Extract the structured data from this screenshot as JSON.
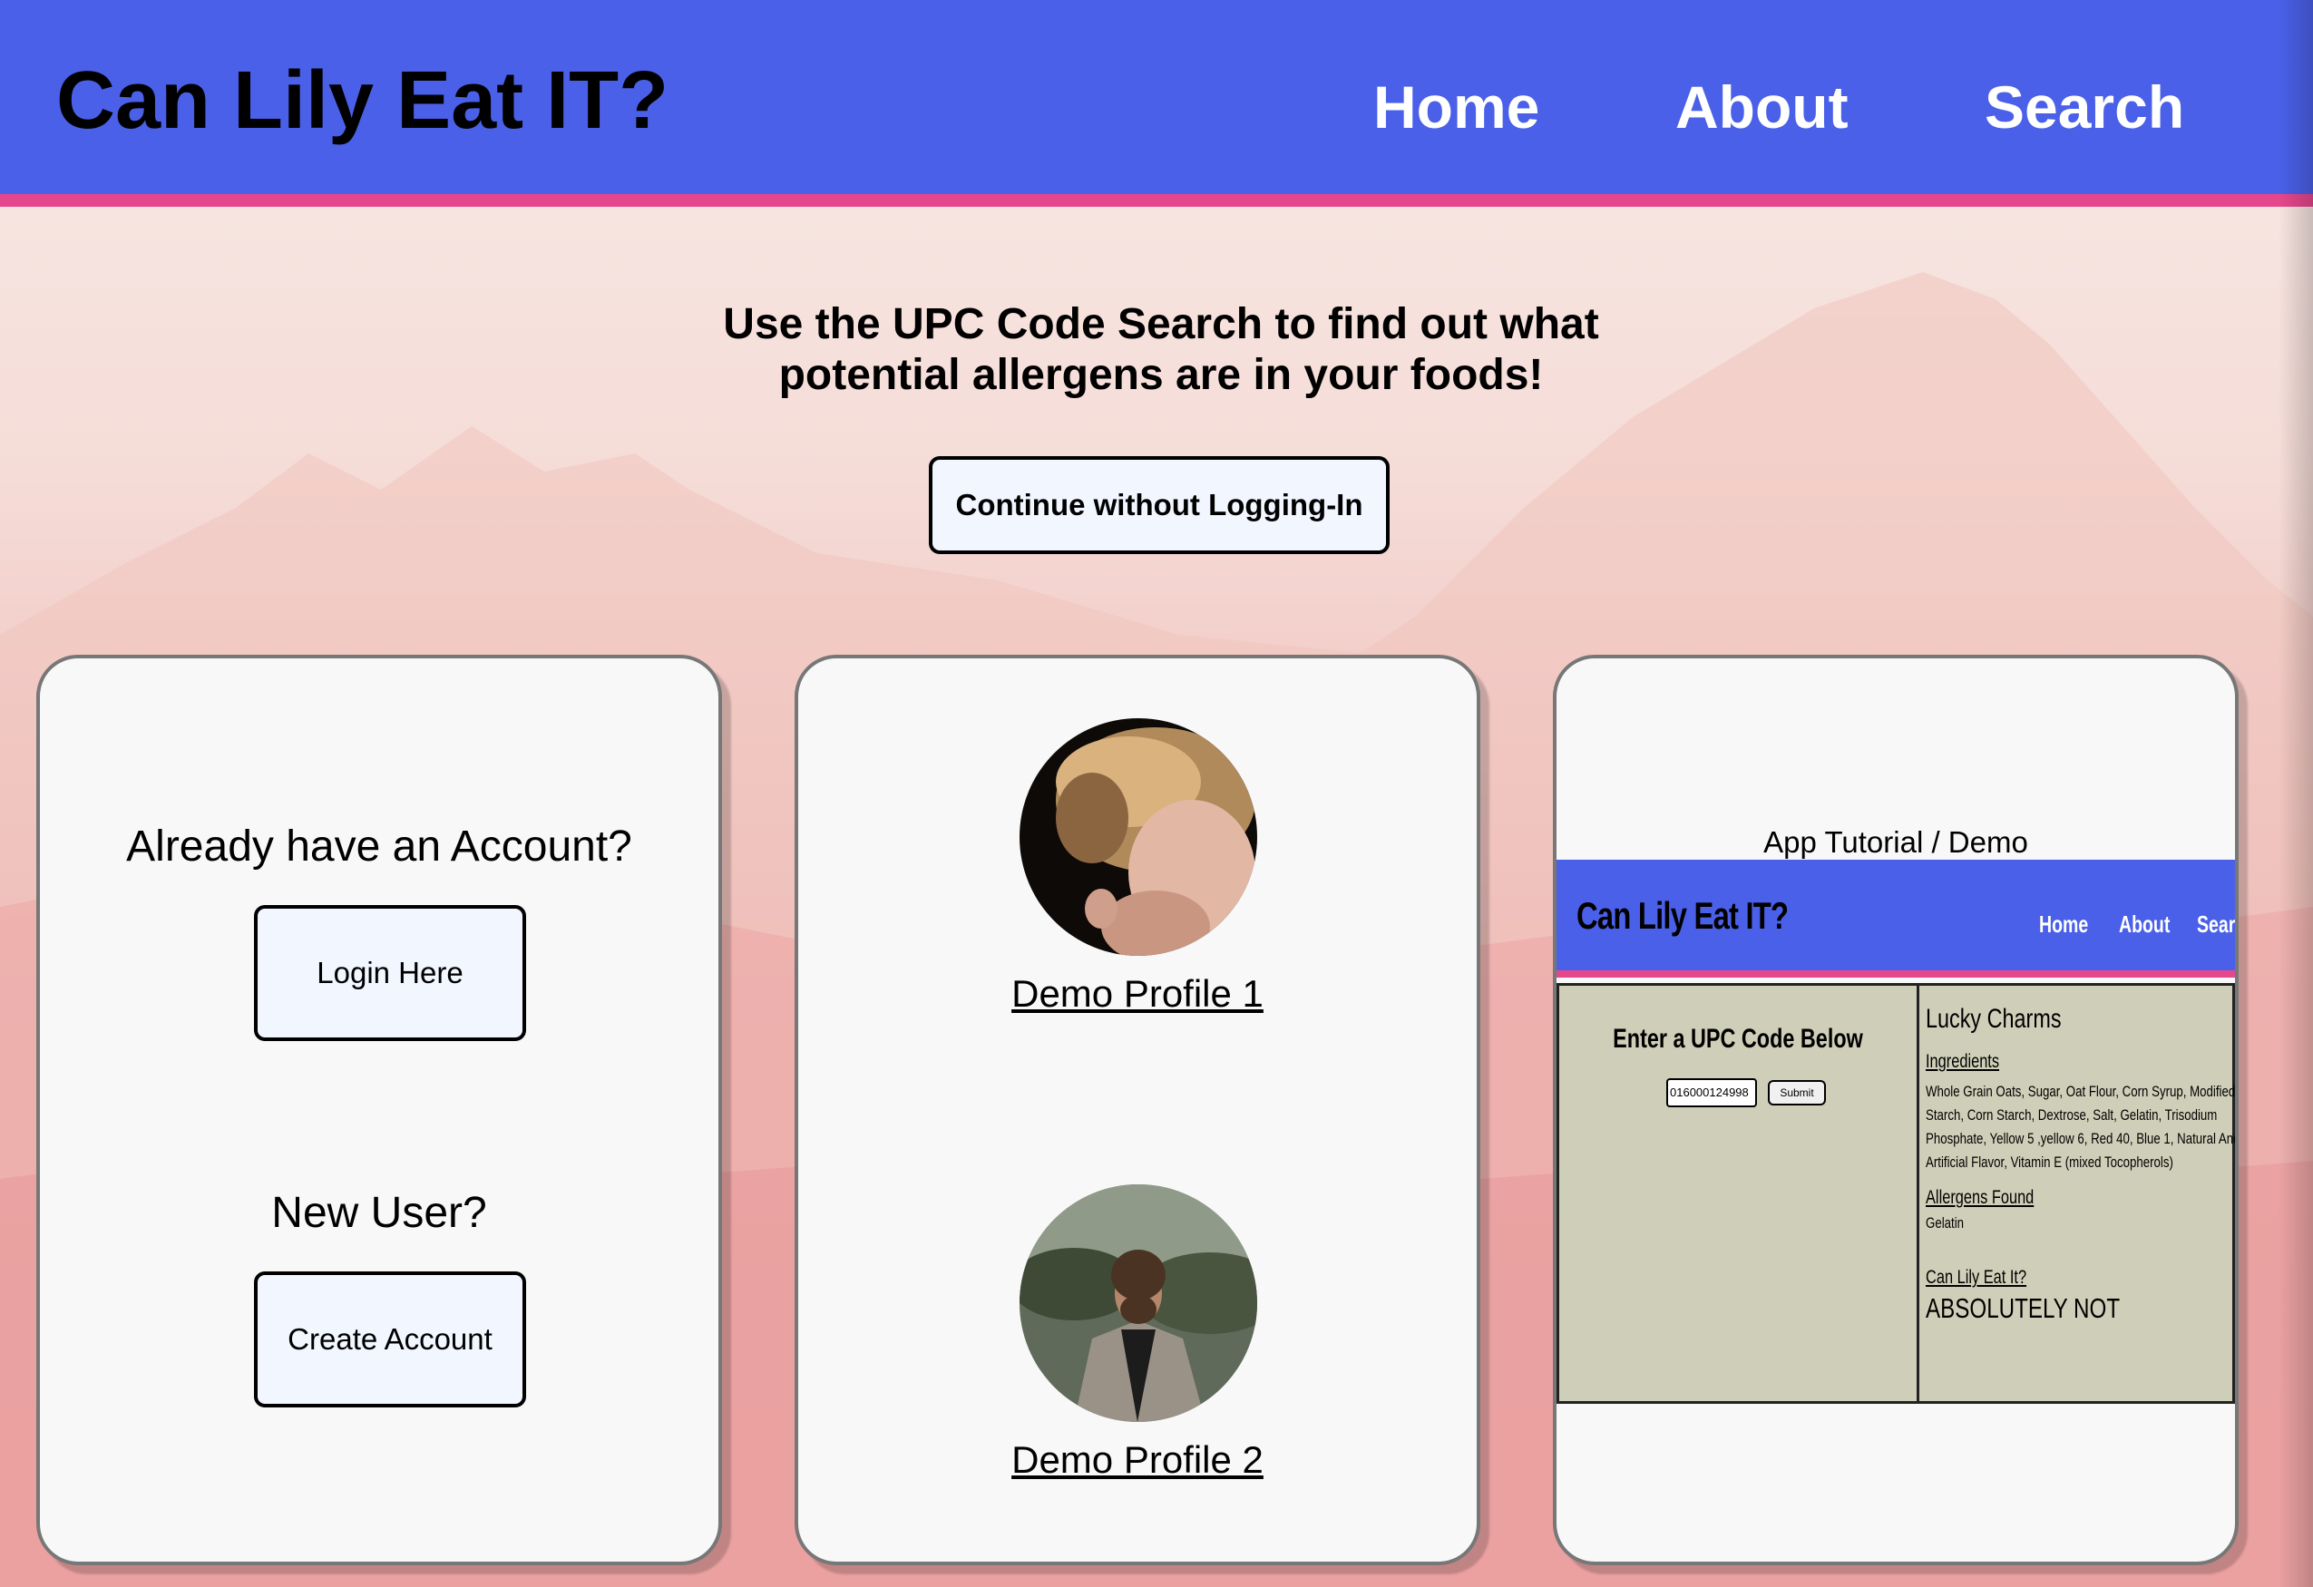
{
  "header": {
    "brand": "Can Lily Eat IT?",
    "nav": [
      {
        "label": "Home"
      },
      {
        "label": "About"
      },
      {
        "label": "Search"
      }
    ]
  },
  "hero": {
    "line1": "Use the UPC Code Search to find out what",
    "line2": "potential allergens are in your foods!",
    "continue_button": "Continue without Logging-In"
  },
  "account_card": {
    "existing_heading": "Already have an Account?",
    "login_button": "Login Here",
    "new_heading": "New User?",
    "create_button": "Create Account"
  },
  "profiles_card": {
    "profiles": [
      {
        "label": "Demo Profile 1"
      },
      {
        "label": "Demo Profile 2"
      }
    ]
  },
  "demo_card": {
    "caption": "App Tutorial / Demo",
    "mini_app": {
      "brand": "Can Lily Eat IT?",
      "nav": [
        "Home",
        "About",
        "Search"
      ],
      "upc_title": "Enter a UPC Code Below",
      "upc_value": "016000124998",
      "submit_label": "Submit",
      "product_name": "Lucky Charms",
      "ingredients_heading": "Ingredients",
      "ingredients_text": "Whole Grain Oats, Sugar, Oat Flour, Corn Syrup, Modified Corn Starch, Corn Starch, Dextrose, Salt, Gelatin, Trisodium Phosphate, Yellow 5 ,yellow 6, Red 40, Blue 1, Natural And Artificial Flavor, Vitamin E (mixed Tocopherols)",
      "allergens_heading": "Allergens Found",
      "allergens_value": "Gelatin",
      "verdict_heading": "Can Lily Eat It?",
      "verdict_value": "ABSOLUTELY NOT"
    }
  },
  "colors": {
    "nav_blue": "#4a60e8",
    "nav_pink_border": "#e5478c",
    "button_bg": "#f1f6ff",
    "card_bg": "#f8f8f8",
    "mini_body_bg": "#cfcfb9"
  }
}
